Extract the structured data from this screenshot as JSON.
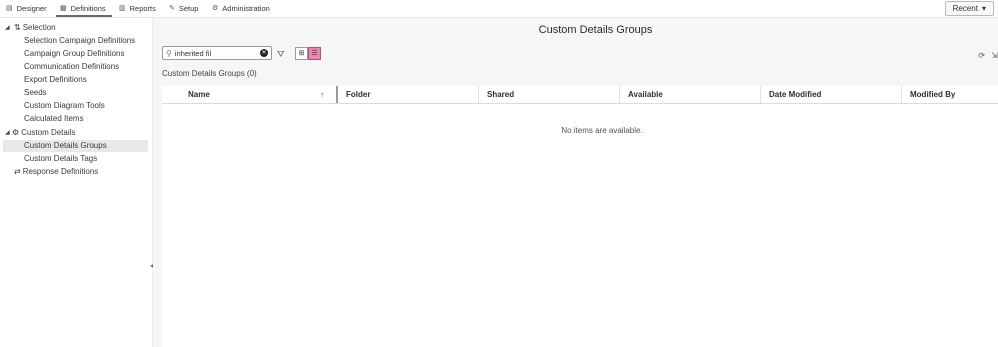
{
  "nav": {
    "tabs": [
      {
        "label": "Designer",
        "icon": "designer-icon"
      },
      {
        "label": "Definitions",
        "icon": "definitions-icon"
      },
      {
        "label": "Reports",
        "icon": "reports-icon"
      },
      {
        "label": "Setup",
        "icon": "wrench-icon"
      },
      {
        "label": "Administration",
        "icon": "admin-icon"
      }
    ],
    "active_tab": "Definitions",
    "recent_label": "Recent"
  },
  "sidebar": {
    "items": [
      {
        "label": "Selection",
        "type": "group"
      },
      {
        "label": "Selection Campaign Definitions"
      },
      {
        "label": "Campaign Group Definitions"
      },
      {
        "label": "Communication Definitions"
      },
      {
        "label": "Export Definitions"
      },
      {
        "label": "Seeds"
      },
      {
        "label": "Custom Diagram Tools"
      },
      {
        "label": "Calculated Items"
      },
      {
        "label": "Custom Details",
        "type": "group"
      },
      {
        "label": "Custom Details Groups",
        "selected": true
      },
      {
        "label": "Custom Details Tags"
      },
      {
        "label": "Response Definitions",
        "type": "group"
      }
    ]
  },
  "main": {
    "title": "Custom Details Groups",
    "search_value": "inherited fil",
    "count_label": "Custom Details Groups (0)",
    "columns": [
      "Name",
      "Folder",
      "Shared",
      "Available",
      "Date Modified",
      "Modified By"
    ],
    "empty_message": "No items are available."
  },
  "colors": {
    "accent": "#e28bb3",
    "background": "#f6f6f6"
  }
}
